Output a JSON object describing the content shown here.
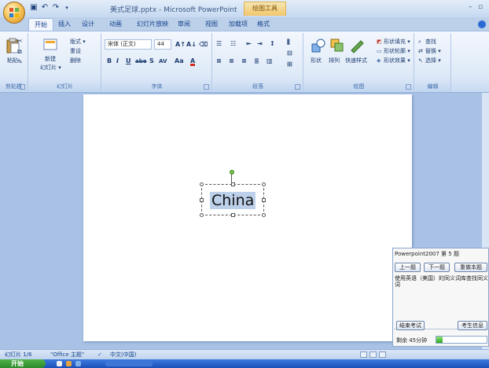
{
  "window": {
    "app_title": "美式足球.pptx - Microsoft PowerPoint",
    "context_tab_title": "绘图工具",
    "qat_icons": [
      "save-icon",
      "undo-icon",
      "redo-icon"
    ]
  },
  "tabs": [
    {
      "label": "开始",
      "active": true
    },
    {
      "label": "插入"
    },
    {
      "label": "设计"
    },
    {
      "label": "动画"
    },
    {
      "label": "幻灯片放映"
    },
    {
      "label": "审阅"
    },
    {
      "label": "视图"
    },
    {
      "label": "加载项"
    },
    {
      "label": "格式"
    }
  ],
  "ribbon": {
    "clipboard": {
      "label": "剪贴板",
      "paste": "粘贴"
    },
    "slides": {
      "label": "幻灯片",
      "new_slide": "新建",
      "new_slide_2": "幻灯片 ▾",
      "layout": "版式 ▾",
      "reset": "重设",
      "delete": "删除"
    },
    "font": {
      "label": "字体",
      "font_name": "宋体 (正文)",
      "font_size": "44",
      "bold": "B",
      "italic": "I",
      "underline": "U",
      "strike": "abe",
      "shadow": "S",
      "spacing": "AV",
      "case": "Aa",
      "color": "A"
    },
    "paragraph": {
      "label": "段落"
    },
    "drawing": {
      "label": "绘图",
      "shape": "形状",
      "arrange": "排列",
      "quick_styles": "快速样式",
      "fill": "形状填充 ▾",
      "outline": "形状轮廓 ▾",
      "effects": "形状效果 ▾"
    },
    "editing": {
      "label": "编辑",
      "find": "查找",
      "replace": "替换 ▾",
      "select": "选择 ▾"
    }
  },
  "slide": {
    "text": "China"
  },
  "exam": {
    "title": "Powerpoint2007 第 5 题",
    "prev": "上一题",
    "next": "下一题",
    "redo": "重做本题",
    "question": "使用英语（美国）的同义词库查找同义词",
    "finish": "结束考试",
    "info": "考生信息",
    "time_left": "剩余 45分钟",
    "time_progress": 0.12
  },
  "status": {
    "slide_pos": "幻灯片 1/6",
    "theme": "\"Office 主题\"",
    "language": "中文(中国)"
  },
  "taskbar": {
    "start": "开始"
  }
}
